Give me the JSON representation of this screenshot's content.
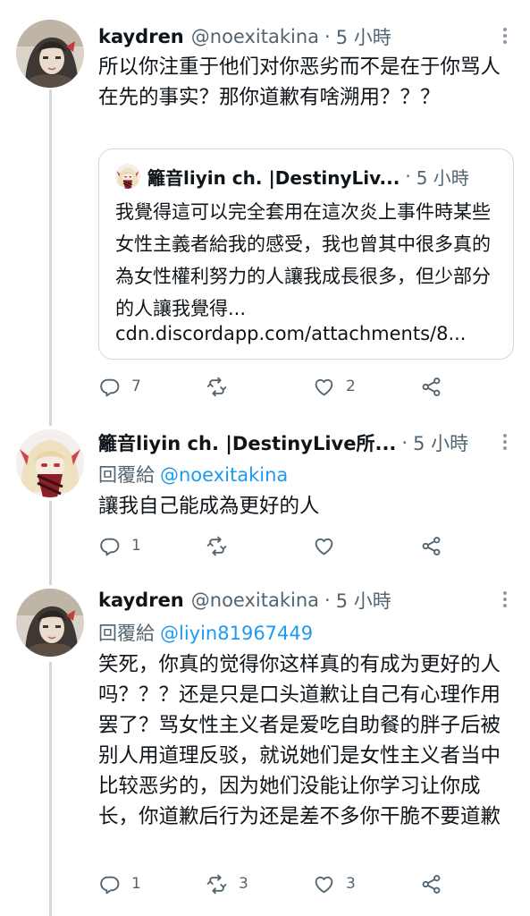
{
  "tweets": [
    {
      "display_name": "kaydren",
      "handle": "@noexitakina",
      "dot": "·",
      "time": "5 小時",
      "text": "所以你注重于他们对你恶劣而不是在于你骂人在先的事实？那你道歉有啥溯用？？？",
      "quote": {
        "display_name": "籬音liyin ch. |DestinyLiv...",
        "dot": "·",
        "time": "5 小時",
        "text": "我覺得這可以完全套用在這次炎上事件時某些女性主義者給我的感受，我也曾其中很多真的為女性權利努力的人讓我成長很多，但少部分的人讓我覺得...",
        "link": "cdn.discordapp.com/attachments/8..."
      },
      "replies": "7",
      "retweets": "",
      "likes": "2"
    },
    {
      "display_name": "籬音liyin ch. |DestinyLive所...",
      "dot": "·",
      "time": "5 小時",
      "reply_label": "回覆給",
      "reply_mention": "@noexitakina",
      "text": "讓我自己能成為更好的人",
      "replies": "1",
      "retweets": "",
      "likes": ""
    },
    {
      "display_name": "kaydren",
      "handle": "@noexitakina",
      "dot": "·",
      "time": "5 小時",
      "reply_label": "回覆給",
      "reply_mention": "@liyin81967449",
      "text": "笑死，你真的觉得你这样真的有成为更好的人吗？？？还是只是口头道歉让自己有心理作用罢了？骂女性主义者是爱吃自助餐的胖子后被别人用道理反驳，就说她们是女性主义者当中比较恶劣的，因为她们没能让你学习让你成长，你道歉后行为还是差不多你干脆不要道歉",
      "replies": "1",
      "retweets": "3",
      "likes": "3"
    }
  ],
  "icons": {
    "reply": "reply-icon",
    "retweet": "retweet-icon",
    "like": "heart-icon",
    "share": "share-icon",
    "more": "more-icon"
  },
  "colors": {
    "text": "#0f1419",
    "muted": "#536471",
    "link": "#1d9bf0",
    "border": "#cfd9de"
  }
}
